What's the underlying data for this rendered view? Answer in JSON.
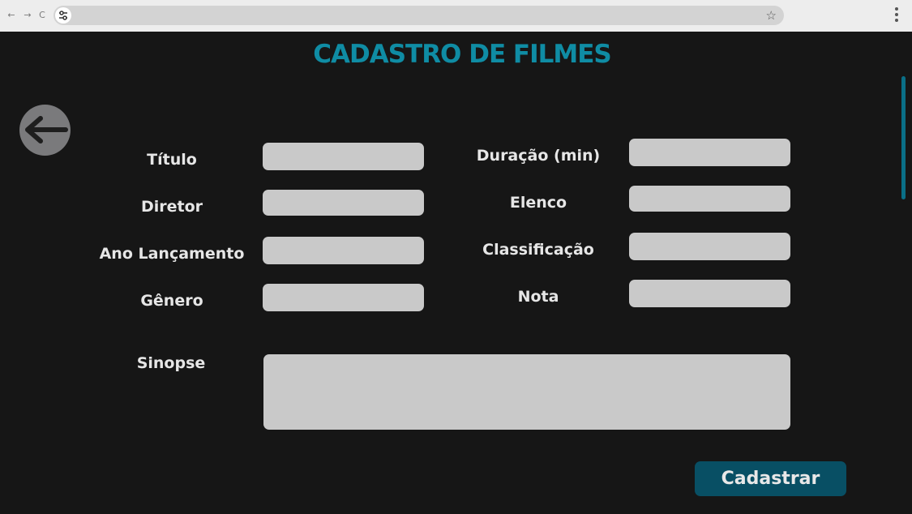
{
  "browser": {
    "back_icon": "arrow-left-icon",
    "forward_icon": "arrow-right-icon",
    "reload_icon": "reload-icon",
    "site_info_icon": "tune-icon",
    "bookmark_icon": "star-icon",
    "menu_icon": "kebab-menu-icon",
    "back_glyph": "←",
    "forward_glyph": "→",
    "reload_glyph": "C",
    "star_glyph": "☆"
  },
  "page": {
    "title": "CADASTRO DE FILMES",
    "back_button_icon": "arrow-left-icon"
  },
  "form": {
    "fields": [
      {
        "label": "Título",
        "value": ""
      },
      {
        "label": "Diretor",
        "value": ""
      },
      {
        "label": "Ano Lançamento",
        "value": ""
      },
      {
        "label": "Gênero",
        "value": ""
      },
      {
        "label": "Duração (min)",
        "value": ""
      },
      {
        "label": "Elenco",
        "value": ""
      },
      {
        "label": "Classificação",
        "value": ""
      },
      {
        "label": "Nota",
        "value": ""
      },
      {
        "label": "Sinopse",
        "value": ""
      }
    ],
    "submit_label": "Cadastrar"
  },
  "colors": {
    "background": "#161616",
    "title": "#0f8ca4",
    "input": "#c9c9c9",
    "button": "#084f64",
    "label": "#e6e6e6"
  }
}
